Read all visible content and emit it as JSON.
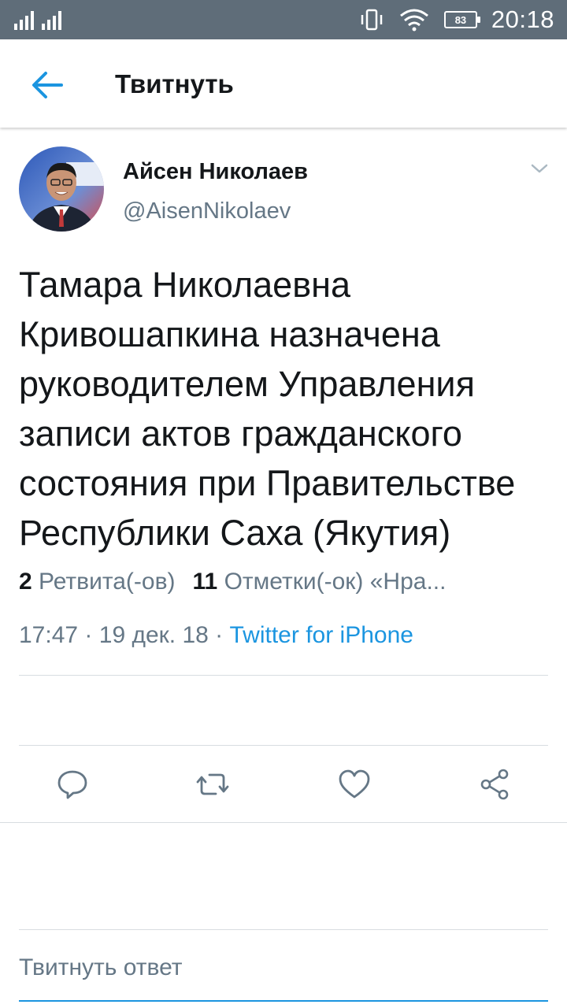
{
  "status_bar": {
    "time": "20:18",
    "battery": "83",
    "icons": [
      "signal-icon",
      "vibrate-icon",
      "wifi-icon",
      "battery-icon"
    ]
  },
  "app_bar": {
    "back_icon": "arrow-left-icon",
    "title": "Твитнуть"
  },
  "tweet": {
    "author_name": "Айсен Николаев",
    "author_handle": "@AisenNikolaev",
    "text": "Тамара Николаевна Кривошапкина назначена руководителем Управления записи актов гражданского состояния при Правительстве Республики Саха (Якутия)",
    "time": "17:47",
    "date": "19 дек. 18",
    "separator": "·",
    "source": "Twitter for iPhone",
    "retweets_count": "2",
    "retweets_label": "Ретвита(-ов)",
    "likes_count": "11",
    "likes_label": "Отметки(-ок) «Нра..."
  },
  "actions": [
    "reply-icon",
    "retweet-icon",
    "like-icon",
    "share-icon"
  ],
  "reply": {
    "placeholder": "Твитнуть ответ"
  },
  "colors": {
    "status_bar": "#5f6d79",
    "accent": "#1b95e0",
    "secondary_text": "#657786",
    "primary_text": "#14171a"
  }
}
